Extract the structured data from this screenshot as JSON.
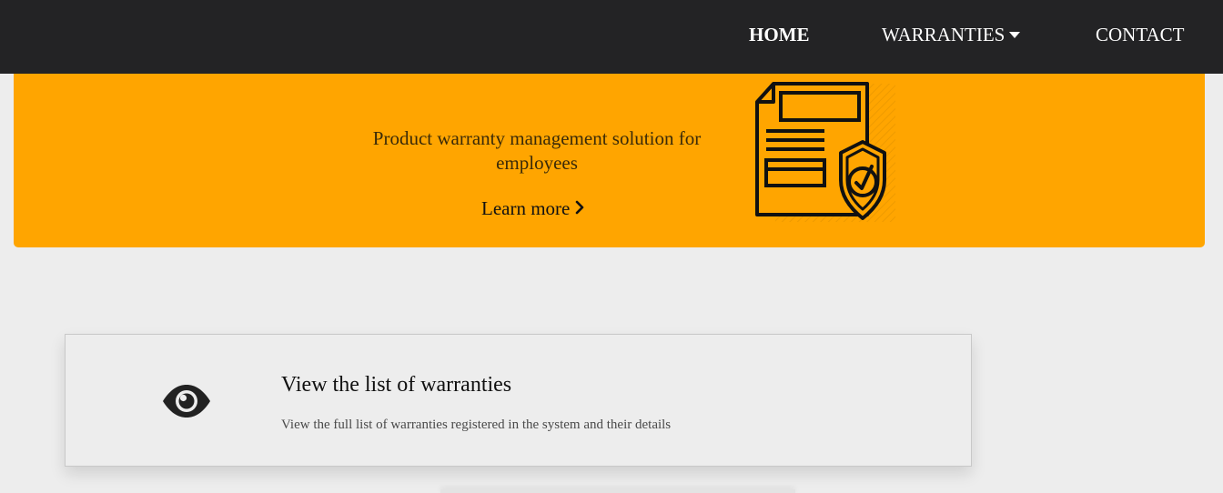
{
  "nav": {
    "items": [
      {
        "label": "HOME",
        "active": true
      },
      {
        "label": "WARRANTIES",
        "has_dropdown": true
      },
      {
        "label": "CONTACT"
      }
    ]
  },
  "hero": {
    "tagline": "Product warranty management solution for employees",
    "cta_label": "Learn more",
    "illustration_icon": "document-shield-icon",
    "background_color": "#ffa500"
  },
  "cards": [
    {
      "icon": "eye-icon",
      "title": "View the list of warranties",
      "description": "View the full list of warranties registered in the system and their details"
    }
  ],
  "colors": {
    "navbar": "#232325",
    "page_background": "#ededed",
    "accent": "#ffa500"
  }
}
